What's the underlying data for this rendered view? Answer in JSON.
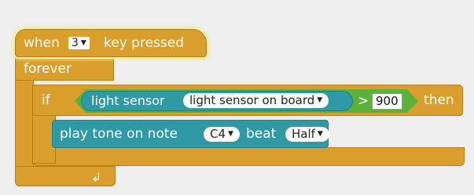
{
  "hat": {
    "prefix": "when",
    "key_value": "3",
    "suffix": "key pressed"
  },
  "forever": {
    "label": "forever",
    "loop_arrow_glyph": "↲"
  },
  "if_block": {
    "if_label": "if",
    "then_label": "then",
    "condition": {
      "reporter_label": "light sensor",
      "reporter_option": "light sensor on board",
      "operator": ">",
      "value": "900"
    }
  },
  "tone_block": {
    "prefix": "play tone on note",
    "note": "C4",
    "beat_label": "beat",
    "beat": "Half"
  },
  "colors": {
    "control_orange": "#d99e2b",
    "operator_green": "#5cb13a",
    "sensor_teal": "#2f9aa6",
    "glow": "#f6f0a6"
  }
}
